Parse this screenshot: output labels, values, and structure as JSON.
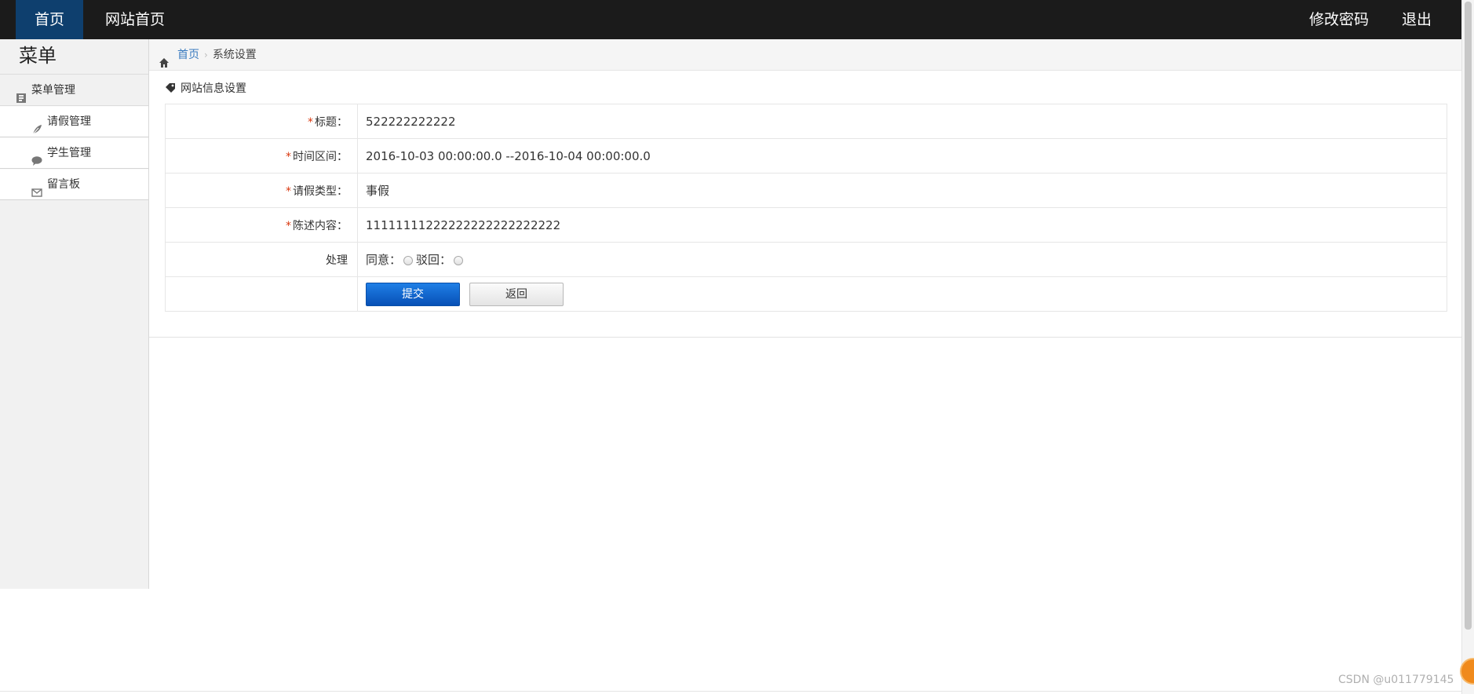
{
  "topnav": {
    "home": "首页",
    "website_home": "网站首页",
    "change_password": "修改密码",
    "logout": "退出"
  },
  "sidebar": {
    "title": "菜单",
    "group": "菜单管理",
    "items": [
      {
        "label": "请假管理",
        "icon": "leaf-icon"
      },
      {
        "label": "学生管理",
        "icon": "comment-icon"
      },
      {
        "label": "留言板",
        "icon": "envelope-icon"
      }
    ]
  },
  "breadcrumb": {
    "home": "首页",
    "current": "系统设置"
  },
  "section": {
    "title": "网站信息设置"
  },
  "form": {
    "rows": [
      {
        "label": "标题：",
        "value": "522222222222",
        "required": true
      },
      {
        "label": "时间区间：",
        "value": "2016-10-03 00:00:00.0 --2016-10-04 00:00:00.0",
        "required": true
      },
      {
        "label": "请假类型：",
        "value": "事假",
        "required": true
      },
      {
        "label": "陈述内容：",
        "value": "11111111222222222222222222",
        "required": true
      }
    ],
    "process_label": "处理",
    "agree_label": "同意：",
    "reject_label": "驳回：",
    "submit": "提交",
    "back": "返回",
    "required_mark": "*"
  },
  "watermark": "CSDN @u011779145",
  "colors": {
    "topbar": "#1b1b1b",
    "nav_active": "#0e3f6e",
    "link": "#3a7bbf",
    "required": "#d9380f",
    "primary_button": "#0750b6"
  }
}
